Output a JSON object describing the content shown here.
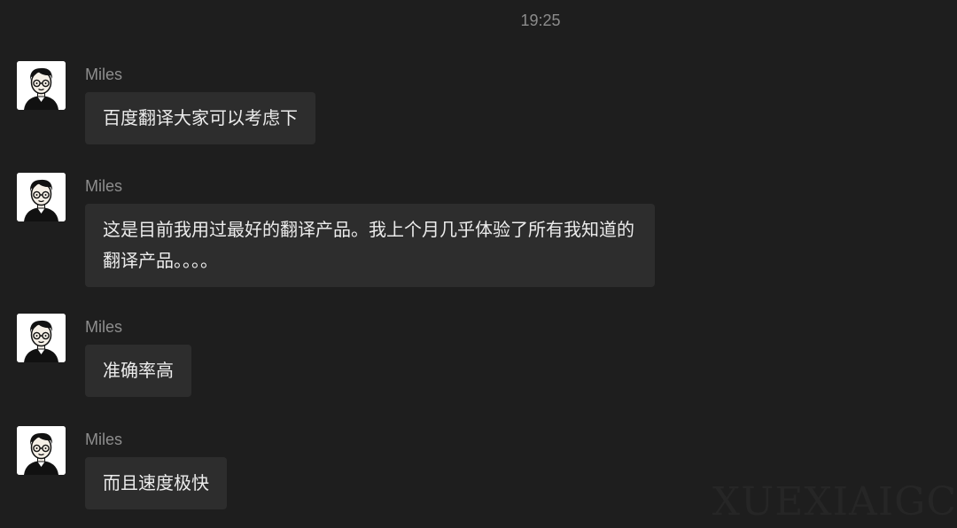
{
  "chat": {
    "timestamp": "19:25",
    "messages": [
      {
        "sender": "Miles",
        "text": "百度翻译大家可以考虑下"
      },
      {
        "sender": "Miles",
        "text": "这是目前我用过最好的翻译产品。我上个月几乎体验了所有我知道的翻译产品。。。。"
      },
      {
        "sender": "Miles",
        "text": "准确率高"
      },
      {
        "sender": "Miles",
        "text": "而且速度极快"
      }
    ]
  },
  "watermark": "XUEXIAIGC"
}
